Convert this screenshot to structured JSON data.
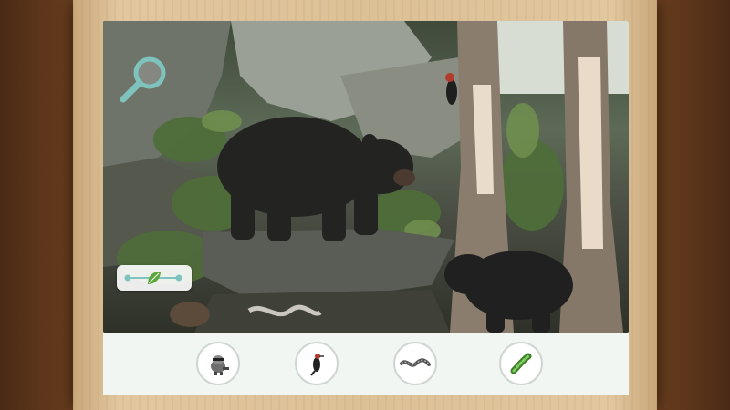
{
  "app": {
    "tray_items": [
      {
        "name": "raccoon",
        "icon": "raccoon-icon"
      },
      {
        "name": "woodpecker",
        "icon": "woodpecker-icon"
      },
      {
        "name": "snake",
        "icon": "snake-icon"
      },
      {
        "name": "caterpillar",
        "icon": "caterpillar-icon"
      }
    ],
    "tools": {
      "magnifier_icon": "magnifier-icon",
      "slider_icon": "leaf-icon",
      "slider_level": 0.5
    }
  },
  "colors": {
    "frame_wood": "#dcc096",
    "background_wood": "#5a3218",
    "tray": "#f2f6f3",
    "accent_teal": "#7fc3be",
    "leaf_green": "#5aa83a"
  }
}
